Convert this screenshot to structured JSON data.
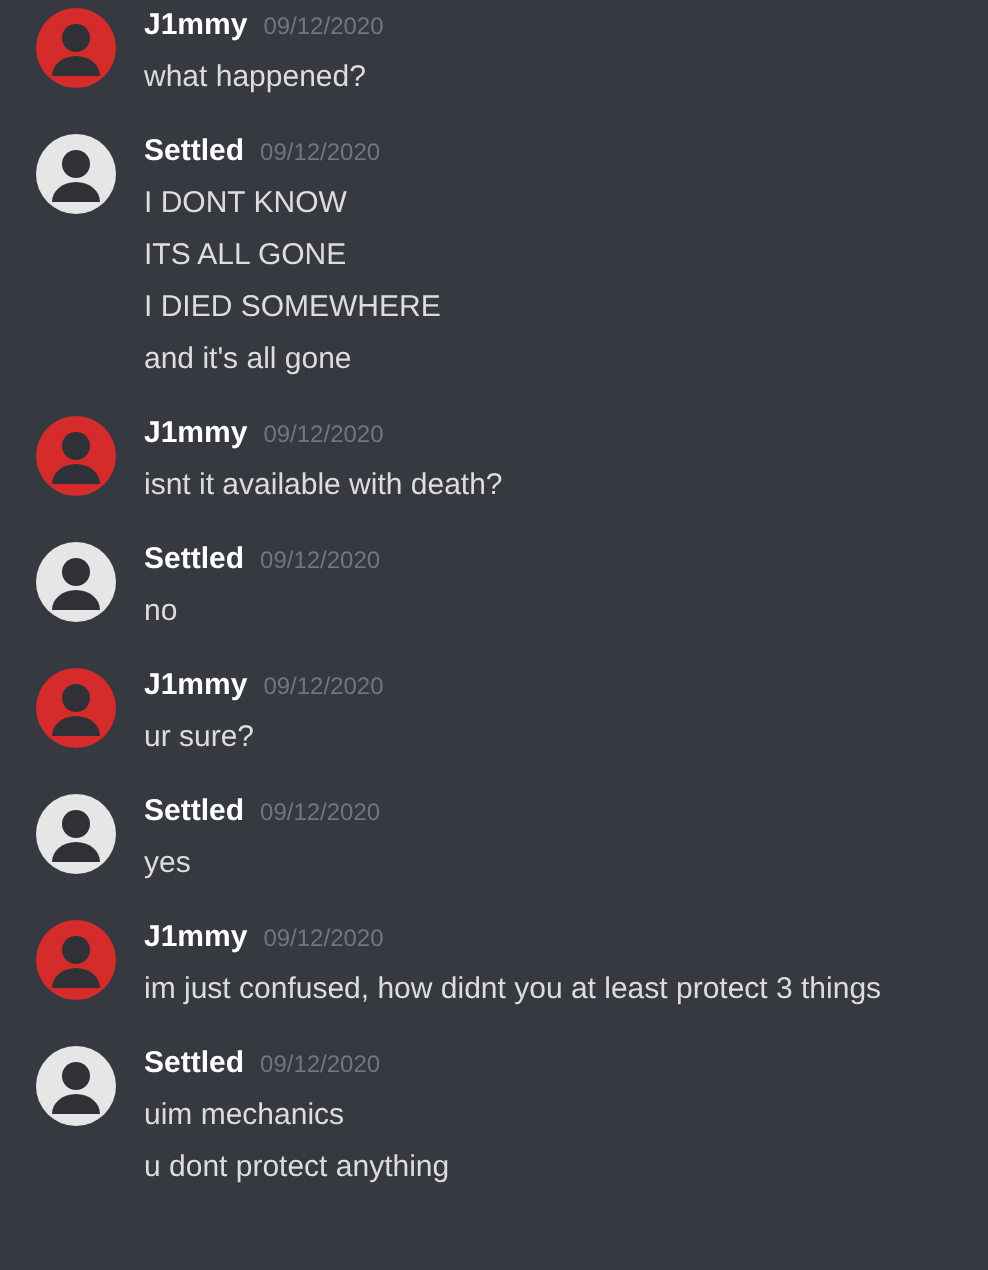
{
  "messages": [
    {
      "author": "J1mmy",
      "color": "#d52b2b",
      "timestamp": "09/12/2020",
      "lines": [
        "what happened?"
      ]
    },
    {
      "author": "Settled",
      "color": "#e6e6e6",
      "timestamp": "09/12/2020",
      "lines": [
        "I DONT KNOW",
        "ITS ALL GONE",
        "I DIED SOMEWHERE",
        "and it's all gone"
      ]
    },
    {
      "author": "J1mmy",
      "color": "#d52b2b",
      "timestamp": "09/12/2020",
      "lines": [
        "isnt it available with death?"
      ]
    },
    {
      "author": "Settled",
      "color": "#e6e6e6",
      "timestamp": "09/12/2020",
      "lines": [
        "no"
      ]
    },
    {
      "author": "J1mmy",
      "color": "#d52b2b",
      "timestamp": "09/12/2020",
      "lines": [
        "ur sure?"
      ]
    },
    {
      "author": "Settled",
      "color": "#e6e6e6",
      "timestamp": "09/12/2020",
      "lines": [
        "yes"
      ]
    },
    {
      "author": "J1mmy",
      "color": "#d52b2b",
      "timestamp": "09/12/2020",
      "lines": [
        "im just confused, how didnt you at least protect 3 things"
      ]
    },
    {
      "author": "Settled",
      "color": "#e6e6e6",
      "timestamp": "09/12/2020",
      "lines": [
        "uim mechanics",
        "u dont protect anything"
      ]
    }
  ]
}
